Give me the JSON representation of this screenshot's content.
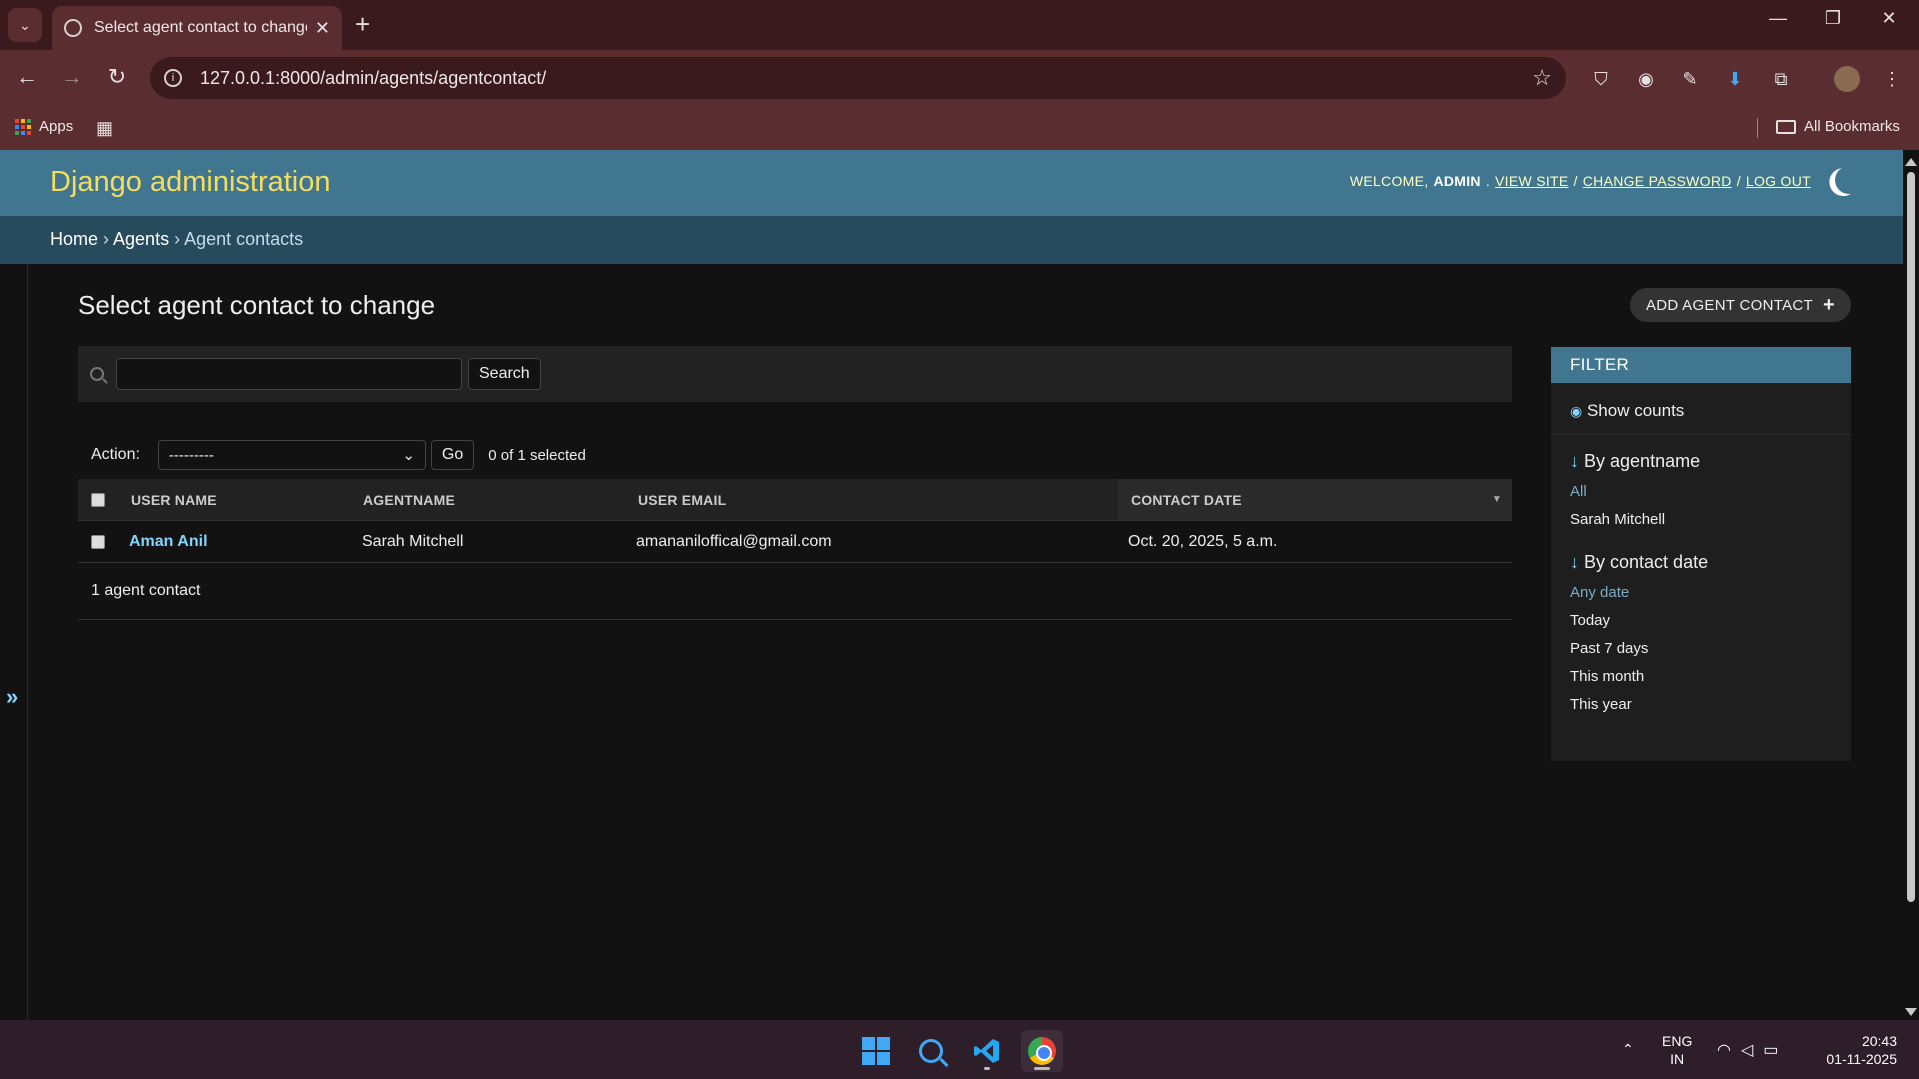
{
  "browser": {
    "tab_title": "Select agent contact to change",
    "url": "127.0.0.1:8000/admin/agents/agentcontact/",
    "bookmarks": {
      "apps_label": "Apps",
      "all_bookmarks_label": "All Bookmarks"
    }
  },
  "admin": {
    "brand": "Django administration",
    "user_tools": {
      "welcome": "WELCOME,",
      "username": "ADMIN",
      "view_site": "VIEW SITE",
      "change_password": "CHANGE PASSWORD",
      "log_out": "LOG OUT"
    },
    "breadcrumbs": {
      "home": "Home",
      "app": "Agents",
      "model": "Agent contacts"
    },
    "title": "Select agent contact to change",
    "add_button": "ADD AGENT CONTACT",
    "search": {
      "value": "",
      "button": "Search"
    },
    "actions": {
      "label": "Action:",
      "selected_option": "---------",
      "go": "Go",
      "selection_count": "0 of 1 selected"
    },
    "table": {
      "headers": [
        "USER NAME",
        "AGENTNAME",
        "USER EMAIL",
        "CONTACT DATE"
      ],
      "rows": [
        {
          "user_name": "Aman Anil",
          "agentname": "Sarah Mitchell",
          "user_email": "amananiloffical@gmail.com",
          "contact_date": "Oct. 20, 2025, 5 a.m."
        }
      ]
    },
    "paginator": "1 agent contact",
    "sidebar_toggle": "»",
    "filter": {
      "title": "FILTER",
      "show_counts": "Show counts",
      "groups": [
        {
          "title": "By agentname",
          "options": [
            "All",
            "Sarah Mitchell"
          ],
          "selected": "All"
        },
        {
          "title": "By contact date",
          "options": [
            "Any date",
            "Today",
            "Past 7 days",
            "This month",
            "This year"
          ],
          "selected": "Any date"
        }
      ]
    }
  },
  "taskbar": {
    "language": "ENG",
    "region": "IN",
    "time": "20:43",
    "date": "01-11-2025"
  },
  "colors": {
    "header_bg": "#417690",
    "breadcrumbs_bg": "#264b5d",
    "brand": "#f5dd5d",
    "link": "#81d4fa",
    "chrome_frame": "#5a2e31"
  }
}
